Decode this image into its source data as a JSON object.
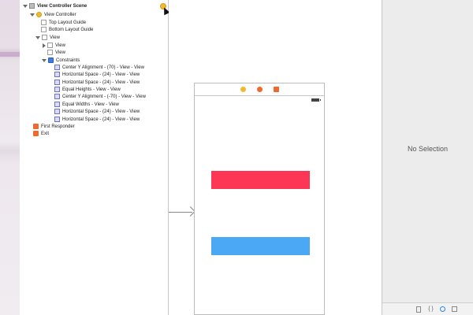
{
  "outline": {
    "scene_title": "View Controller Scene",
    "view_controller": "View Controller",
    "top_layout_guide": "Top Layout Guide",
    "bottom_layout_guide": "Bottom Layout Guide",
    "view": "View",
    "subview_1": "View",
    "subview_2": "View",
    "constraints_label": "Constraints",
    "constraints": [
      "Center Y Alignment - (70) - View - View",
      "Horizontal Space - (24) - View - View",
      "Horizontal Space - (24) - View - View",
      "Equal Heights - View - View",
      "Center Y Alignment - (-70) - View - View",
      "Equal Widths - View - View",
      "Horizontal Space - (24) - View - View",
      "Horizontal Space - (24) - View - View"
    ],
    "first_responder": "First Responder",
    "exit": "Exit"
  },
  "canvas": {
    "red_view_color": "#fd3656",
    "blue_view_color": "#4aa8f5"
  },
  "inspector": {
    "empty_label": "No Selection",
    "braces_glyph": "{ }"
  }
}
